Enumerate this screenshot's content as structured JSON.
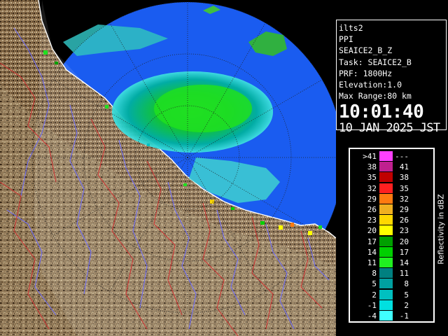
{
  "info": {
    "site": "ilts2",
    "product": "PPI",
    "field": "SEAICE2_B_Z",
    "task": "Task: SEAICE2_B",
    "prf": "PRF: 1800Hz",
    "elevation": "Elevation:1.0",
    "max_range": "Max Range:80 km",
    "time": "10:01:40",
    "date": "10 JAN 2025 JST"
  },
  "legend": {
    "title": "Reflectivity in dBZ",
    "rows": [
      {
        "left": ">41",
        "right": "---",
        "color": "#ff40ff"
      },
      {
        "left": "38",
        "right": "41",
        "color": "#c0208f"
      },
      {
        "left": "35",
        "right": "38",
        "color": "#c00000"
      },
      {
        "left": "32",
        "right": "35",
        "color": "#ff2020"
      },
      {
        "left": "29",
        "right": "32",
        "color": "#ff7a10"
      },
      {
        "left": "26",
        "right": "29",
        "color": "#f0b020"
      },
      {
        "left": "23",
        "right": "26",
        "color": "#ffd800"
      },
      {
        "left": "20",
        "right": "23",
        "color": "#ffff00"
      },
      {
        "left": "17",
        "right": "20",
        "color": "#00a000"
      },
      {
        "left": "14",
        "right": "17",
        "color": "#00d000"
      },
      {
        "left": "11",
        "right": "14",
        "color": "#20f020"
      },
      {
        "left": "8",
        "right": "11",
        "color": "#008080"
      },
      {
        "left": "5",
        "right": "8",
        "color": "#00a0a0"
      },
      {
        "left": "2",
        "right": "5",
        "color": "#00c0c0"
      },
      {
        "left": "-1",
        "right": "2",
        "color": "#00e0e0"
      },
      {
        "left": "-4",
        "right": "-1",
        "color": "#40ffff"
      }
    ]
  },
  "colors": {
    "sea_echo": "#1a5cf0",
    "land": "#8a6e4c",
    "coast": "#ffffff",
    "rivers": "#6a6aff",
    "boundaries": "#d03030"
  }
}
